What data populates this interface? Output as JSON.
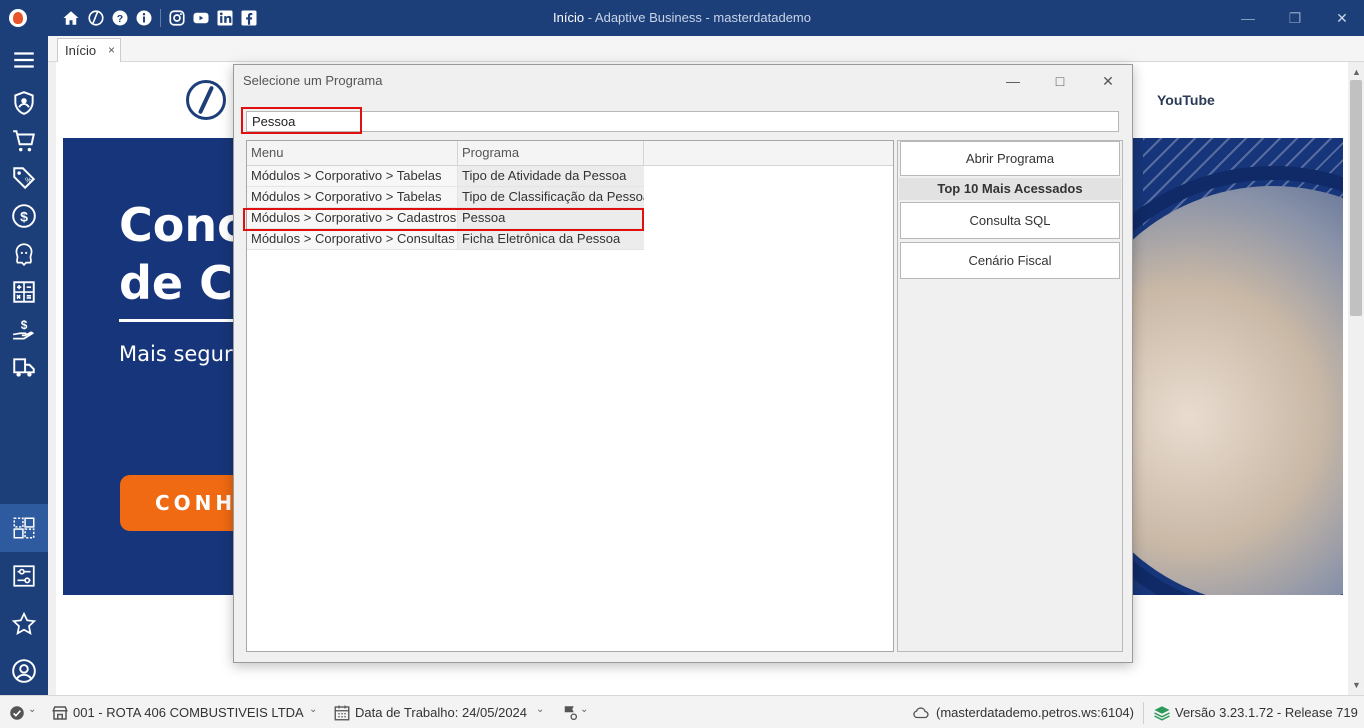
{
  "window": {
    "title_main": "Início",
    "title_rest": " - Adaptive Business - masterdatademo"
  },
  "tabs": [
    {
      "label": "Início",
      "close": "×"
    }
  ],
  "background": {
    "brand_link": "YouTube",
    "banner_heading_line1": "Conc",
    "banner_heading_line2": "de Ca",
    "banner_subtitle": "Mais segur",
    "banner_cta": "CONH"
  },
  "dialog": {
    "title": "Selecione um Programa",
    "search_value": "Pessoa",
    "columns": [
      "Menu",
      "Programa"
    ],
    "rows": [
      {
        "menu": "Módulos > Corporativo > Tabelas",
        "programa": "Tipo de Atividade da Pessoa"
      },
      {
        "menu": "Módulos > Corporativo > Tabelas",
        "programa": "Tipo de Classificação da Pessoa"
      },
      {
        "menu": "Módulos > Corporativo > Cadastros",
        "programa": "Pessoa"
      },
      {
        "menu": "Módulos > Corporativo > Consultas",
        "programa": "Ficha Eletrônica da Pessoa"
      }
    ],
    "open_button": "Abrir Programa",
    "top10_header": "Top 10 Mais Acessados",
    "top10": [
      "Consulta SQL",
      "Cenário Fiscal"
    ]
  },
  "statusbar": {
    "company": "001 - ROTA 406 COMBUSTIVEIS LTDA",
    "work_date": "Data de Trabalho: 24/05/2024",
    "server": "(masterdatademo.petros.ws:6104)",
    "version": "Versão 3.23.1.72 - Release 719"
  },
  "colors": {
    "titlebar": "#1c3f7a",
    "highlight": "#e01010",
    "cta": "#ef6a12"
  }
}
